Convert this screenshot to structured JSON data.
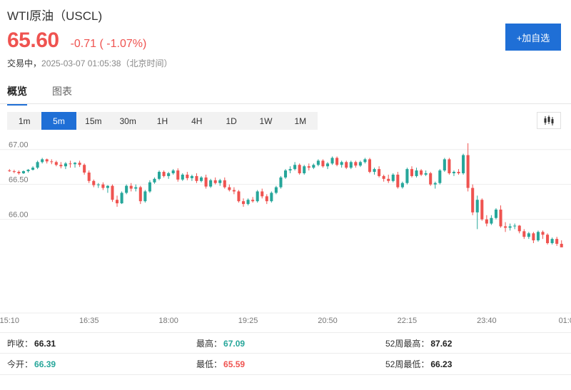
{
  "header": {
    "title": "WTI原油（USCL)",
    "price": "65.60",
    "change": "-0.71 ( -1.07%)",
    "status_state": "交易中，",
    "status_time": "2025-03-07 01:05:38（北京时间）",
    "watch_label": "+加自选"
  },
  "tabs": [
    "概览",
    "图表"
  ],
  "intervals": [
    "1m",
    "5m",
    "15m",
    "30m",
    "1H",
    "4H",
    "1D",
    "1W",
    "1M"
  ],
  "active_interval": "5m",
  "colors": {
    "up": "#26a69a",
    "down": "#ef5350",
    "accent": "#1f6fd6"
  },
  "chart_data": {
    "type": "candlestick",
    "title": "",
    "xlabel": "",
    "ylabel": "",
    "ylim": [
      64.68,
      67.15
    ],
    "yticks": [
      {
        "value": 67.0,
        "label": "67.00"
      },
      {
        "value": 66.5,
        "label": "66.50"
      },
      {
        "value": 66.0,
        "label": "66.00"
      }
    ],
    "xticks": [
      "15:10",
      "16:35",
      "18:00",
      "19:25",
      "20:50",
      "22:15",
      "23:40",
      "01:0"
    ],
    "xtick_index": [
      0,
      17,
      34,
      51,
      68,
      85,
      102,
      119
    ],
    "series": [
      {
        "ohlc": [
          [
            66.7,
            66.72,
            66.68,
            66.69
          ],
          [
            66.69,
            66.71,
            66.66,
            66.68
          ],
          [
            66.68,
            66.7,
            66.64,
            66.66
          ],
          [
            66.66,
            66.7,
            66.65,
            66.69
          ],
          [
            66.69,
            66.72,
            66.67,
            66.71
          ],
          [
            66.71,
            66.76,
            66.7,
            66.74
          ],
          [
            66.74,
            66.84,
            66.72,
            66.82
          ],
          [
            66.82,
            66.88,
            66.8,
            66.86
          ],
          [
            66.86,
            66.87,
            66.8,
            66.83
          ],
          [
            66.83,
            66.86,
            66.79,
            66.82
          ],
          [
            66.82,
            66.84,
            66.76,
            66.78
          ],
          [
            66.78,
            66.82,
            66.73,
            66.76
          ],
          [
            66.76,
            66.82,
            66.72,
            66.8
          ],
          [
            66.8,
            66.84,
            66.74,
            66.79
          ],
          [
            66.79,
            66.82,
            66.74,
            66.81
          ],
          [
            66.81,
            66.84,
            66.75,
            66.78
          ],
          [
            66.78,
            66.8,
            66.64,
            66.67
          ],
          [
            66.67,
            66.7,
            66.52,
            66.55
          ],
          [
            66.55,
            66.57,
            66.46,
            66.49
          ],
          [
            66.49,
            66.52,
            66.45,
            66.5
          ],
          [
            66.5,
            66.53,
            66.42,
            66.45
          ],
          [
            66.45,
            66.49,
            66.38,
            66.48
          ],
          [
            66.48,
            66.5,
            66.25,
            66.28
          ],
          [
            66.28,
            66.34,
            66.18,
            66.23
          ],
          [
            66.23,
            66.4,
            66.22,
            66.38
          ],
          [
            66.38,
            66.5,
            66.36,
            66.48
          ],
          [
            66.48,
            66.52,
            66.4,
            66.44
          ],
          [
            66.44,
            66.5,
            66.4,
            66.46
          ],
          [
            66.46,
            66.48,
            66.22,
            66.26
          ],
          [
            66.26,
            66.42,
            66.24,
            66.4
          ],
          [
            66.4,
            66.56,
            66.38,
            66.53
          ],
          [
            66.53,
            66.6,
            66.51,
            66.58
          ],
          [
            66.58,
            66.7,
            66.56,
            66.68
          ],
          [
            66.68,
            66.7,
            66.6,
            66.62
          ],
          [
            66.62,
            66.68,
            66.58,
            66.66
          ],
          [
            66.66,
            66.72,
            66.64,
            66.7
          ],
          [
            66.7,
            66.73,
            66.54,
            66.57
          ],
          [
            66.57,
            66.66,
            66.55,
            66.64
          ],
          [
            66.64,
            66.68,
            66.56,
            66.59
          ],
          [
            66.59,
            66.64,
            66.55,
            66.62
          ],
          [
            66.62,
            66.66,
            66.52,
            66.55
          ],
          [
            66.55,
            66.62,
            66.53,
            66.6
          ],
          [
            66.6,
            66.64,
            66.44,
            66.47
          ],
          [
            66.47,
            66.58,
            66.45,
            66.56
          ],
          [
            66.56,
            66.6,
            66.5,
            66.52
          ],
          [
            66.52,
            66.58,
            66.48,
            66.56
          ],
          [
            66.56,
            66.6,
            66.44,
            66.46
          ],
          [
            66.46,
            66.5,
            66.4,
            66.42
          ],
          [
            66.42,
            66.46,
            66.36,
            66.4
          ],
          [
            66.4,
            66.42,
            66.24,
            66.26
          ],
          [
            66.26,
            66.3,
            66.18,
            66.22
          ],
          [
            66.22,
            66.3,
            66.2,
            66.28
          ],
          [
            66.28,
            66.32,
            66.24,
            66.26
          ],
          [
            66.26,
            66.42,
            66.24,
            66.4
          ],
          [
            66.4,
            66.44,
            66.3,
            66.33
          ],
          [
            66.33,
            66.36,
            66.22,
            66.26
          ],
          [
            66.26,
            66.4,
            66.24,
            66.38
          ],
          [
            66.38,
            66.48,
            66.36,
            66.46
          ],
          [
            66.46,
            66.62,
            66.44,
            66.6
          ],
          [
            66.6,
            66.72,
            66.58,
            66.7
          ],
          [
            66.7,
            66.76,
            66.66,
            66.72
          ],
          [
            66.72,
            66.82,
            66.7,
            66.78
          ],
          [
            66.78,
            66.8,
            66.64,
            66.66
          ],
          [
            66.66,
            66.78,
            66.64,
            66.76
          ],
          [
            66.76,
            66.8,
            66.7,
            66.74
          ],
          [
            66.74,
            66.8,
            66.72,
            66.78
          ],
          [
            66.78,
            66.86,
            66.76,
            66.84
          ],
          [
            66.84,
            66.86,
            66.74,
            66.76
          ],
          [
            66.76,
            66.82,
            66.72,
            66.8
          ],
          [
            66.8,
            66.9,
            66.78,
            66.88
          ],
          [
            66.88,
            66.9,
            66.76,
            66.78
          ],
          [
            66.78,
            66.84,
            66.74,
            66.82
          ],
          [
            66.82,
            66.84,
            66.72,
            66.74
          ],
          [
            66.74,
            66.84,
            66.72,
            66.82
          ],
          [
            66.82,
            66.84,
            66.74,
            66.77
          ],
          [
            66.77,
            66.84,
            66.75,
            66.82
          ],
          [
            66.82,
            66.88,
            66.8,
            66.86
          ],
          [
            66.86,
            66.88,
            66.66,
            66.68
          ],
          [
            66.68,
            66.74,
            66.64,
            66.72
          ],
          [
            66.72,
            66.76,
            66.6,
            66.62
          ],
          [
            66.62,
            66.64,
            66.54,
            66.58
          ],
          [
            66.58,
            66.64,
            66.52,
            66.55
          ],
          [
            66.55,
            66.66,
            66.53,
            66.64
          ],
          [
            66.64,
            66.68,
            66.44,
            66.46
          ],
          [
            66.46,
            66.54,
            66.44,
            66.52
          ],
          [
            66.52,
            66.74,
            66.5,
            66.72
          ],
          [
            66.72,
            66.76,
            66.6,
            66.62
          ],
          [
            66.62,
            66.74,
            66.6,
            66.7
          ],
          [
            66.7,
            66.72,
            66.62,
            66.64
          ],
          [
            66.64,
            66.7,
            66.62,
            66.66
          ],
          [
            66.66,
            66.68,
            66.48,
            66.5
          ],
          [
            66.5,
            66.54,
            66.44,
            66.52
          ],
          [
            66.52,
            66.72,
            66.5,
            66.7
          ],
          [
            66.7,
            66.88,
            66.68,
            66.86
          ],
          [
            66.86,
            66.88,
            66.64,
            66.66
          ],
          [
            66.66,
            66.7,
            66.62,
            66.68
          ],
          [
            66.68,
            66.72,
            66.64,
            66.66
          ],
          [
            66.66,
            66.94,
            66.64,
            66.92
          ],
          [
            66.92,
            67.09,
            66.4,
            66.45
          ],
          [
            66.45,
            66.5,
            66.06,
            66.1
          ],
          [
            66.1,
            66.34,
            65.86,
            66.28
          ],
          [
            66.28,
            66.3,
            65.98,
            66.0
          ],
          [
            66.0,
            66.06,
            65.9,
            65.94
          ],
          [
            65.94,
            66.06,
            65.92,
            66.02
          ],
          [
            66.02,
            66.16,
            66.0,
            66.14
          ],
          [
            66.14,
            66.2,
            65.88,
            65.9
          ],
          [
            65.9,
            65.96,
            65.82,
            65.88
          ],
          [
            65.88,
            65.94,
            65.84,
            65.9
          ],
          [
            65.9,
            65.94,
            65.86,
            65.91
          ],
          [
            65.91,
            65.92,
            65.8,
            65.83
          ],
          [
            65.83,
            65.86,
            65.72,
            65.75
          ],
          [
            65.75,
            65.82,
            65.72,
            65.8
          ],
          [
            65.8,
            65.82,
            65.66,
            65.7
          ],
          [
            65.7,
            65.84,
            65.68,
            65.82
          ],
          [
            65.82,
            65.84,
            65.72,
            65.78
          ],
          [
            65.78,
            65.8,
            65.64,
            65.66
          ],
          [
            65.66,
            65.74,
            65.64,
            65.72
          ],
          [
            65.72,
            65.75,
            65.62,
            65.65
          ],
          [
            65.65,
            65.7,
            65.6,
            65.6
          ]
        ]
      }
    ]
  },
  "stats": [
    [
      {
        "label": "昨收：",
        "value": "66.31",
        "tone": "neutral"
      },
      {
        "label": "最高：",
        "value": "67.09",
        "tone": "up"
      },
      {
        "label": "52周最高：",
        "value": "87.62",
        "tone": "neutral"
      }
    ],
    [
      {
        "label": "今开：",
        "value": "66.39",
        "tone": "up"
      },
      {
        "label": "最低：",
        "value": "65.59",
        "tone": "down"
      },
      {
        "label": "52周最低：",
        "value": "66.23",
        "tone": "neutral"
      }
    ]
  ]
}
